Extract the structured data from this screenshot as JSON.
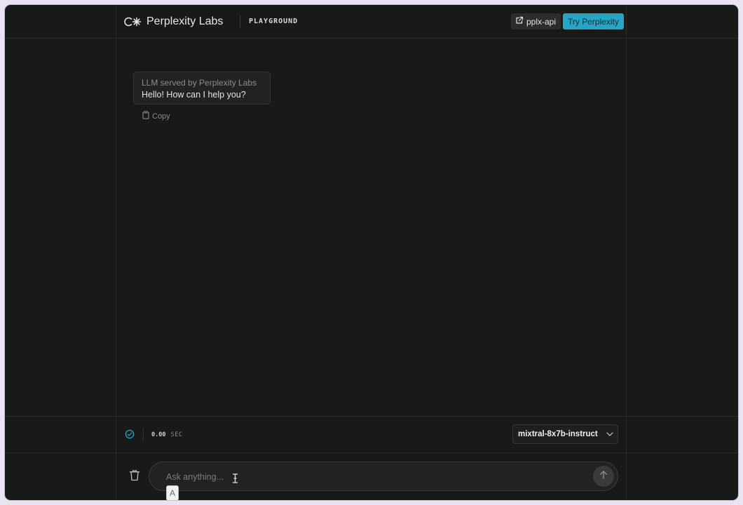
{
  "header": {
    "brand_name": "Perplexity Labs",
    "section_label": "PLAYGROUND",
    "api_button_label": "pplx-api",
    "try_button_label": "Try Perplexity",
    "accent_color": "#27a5c4"
  },
  "conversation": {
    "messages": [
      {
        "meta": "LLM served by Perplexity Labs",
        "text": "Hello! How can I help you?",
        "copy_label": "Copy"
      }
    ]
  },
  "status_bar": {
    "elapsed_value": "0.00",
    "elapsed_unit": "SEC",
    "model_selected": "mixtral-8x7b-instruct"
  },
  "composer": {
    "placeholder": "Ask anything...",
    "ime_indicator": "A"
  }
}
